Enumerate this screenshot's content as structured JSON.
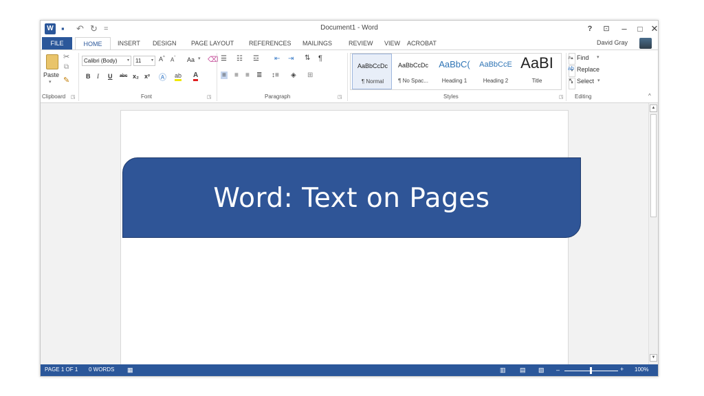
{
  "window": {
    "title": "Document1 - Word",
    "user": "David Gray"
  },
  "tabs": [
    "FILE",
    "HOME",
    "INSERT",
    "DESIGN",
    "PAGE LAYOUT",
    "REFERENCES",
    "MAILINGS",
    "REVIEW",
    "VIEW",
    "ACROBAT"
  ],
  "clipboard": {
    "paste_label": "Paste",
    "group_label": "Clipboard"
  },
  "font": {
    "name": "Calibri (Body)",
    "size": "11",
    "group_label": "Font",
    "change_case": "Aa",
    "bold": "B",
    "italic": "I",
    "underline": "U",
    "strikethrough": "abc",
    "subscript": "x₂",
    "superscript": "x²"
  },
  "paragraph": {
    "group_label": "Paragraph"
  },
  "styles": {
    "group_label": "Styles",
    "items": [
      {
        "sample": "AaBbCcDc",
        "name": "¶ Normal"
      },
      {
        "sample": "AaBbCcDc",
        "name": "¶ No Spac..."
      },
      {
        "sample": "AaBbC(",
        "name": "Heading 1"
      },
      {
        "sample": "AaBbCcE",
        "name": "Heading 2"
      },
      {
        "sample": "AaBI",
        "name": "Title"
      }
    ]
  },
  "editing": {
    "group_label": "Editing",
    "find": "Find",
    "replace": "Replace",
    "select": "Select"
  },
  "status": {
    "page": "PAGE 1 OF 1",
    "words": "0 WORDS",
    "zoom": "100%"
  },
  "banner": {
    "text": "Word: Text on Pages"
  },
  "colors": {
    "accent": "#2b579a",
    "banner": "#2f5597"
  }
}
